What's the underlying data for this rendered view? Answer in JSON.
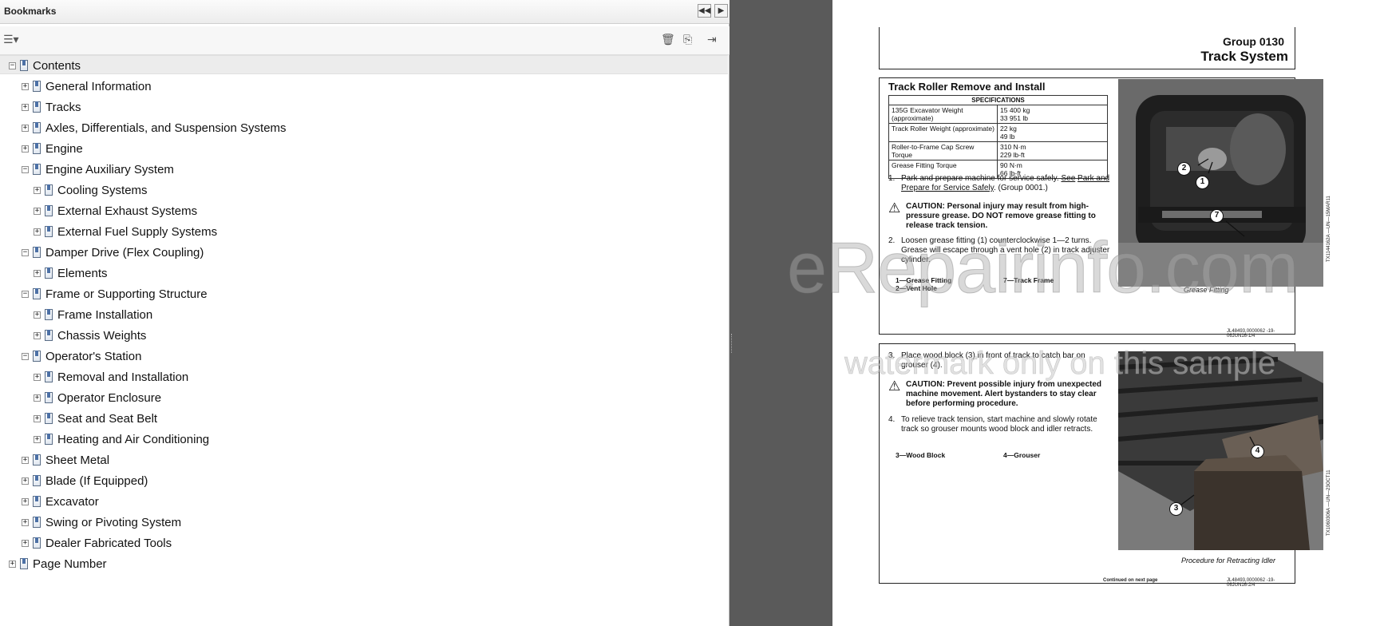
{
  "bookmarks": {
    "title": "Bookmarks",
    "header_buttons": [
      {
        "icon": "double-left-icon",
        "glyph": "◀◀"
      },
      {
        "icon": "play-right-icon",
        "glyph": "▶"
      }
    ],
    "toolbar": {
      "options_icon": "options-menu-icon",
      "delete_icon": "trash-icon",
      "new_bookmark_icon": "new-bookmark-icon",
      "expand_icon": "expand-bookmark-icon"
    },
    "tree": [
      {
        "label": "Contents",
        "level": 0,
        "expander": "−",
        "selected": true
      },
      {
        "label": "General Information",
        "level": 1,
        "expander": "+"
      },
      {
        "label": "Tracks",
        "level": 1,
        "expander": "+"
      },
      {
        "label": "Axles, Differentials, and Suspension Systems",
        "level": 1,
        "expander": "+"
      },
      {
        "label": "Engine",
        "level": 1,
        "expander": "+"
      },
      {
        "label": "Engine Auxiliary System",
        "level": 1,
        "expander": "−"
      },
      {
        "label": "Cooling Systems",
        "level": 2,
        "expander": "+"
      },
      {
        "label": "External Exhaust Systems",
        "level": 2,
        "expander": "+"
      },
      {
        "label": "External Fuel Supply Systems",
        "level": 2,
        "expander": "+"
      },
      {
        "label": "Damper Drive (Flex Coupling)",
        "level": 1,
        "expander": "−"
      },
      {
        "label": "Elements",
        "level": 2,
        "expander": "+"
      },
      {
        "label": "Frame or Supporting Structure",
        "level": 1,
        "expander": "−"
      },
      {
        "label": "Frame Installation",
        "level": 2,
        "expander": "+"
      },
      {
        "label": "Chassis Weights",
        "level": 2,
        "expander": "+"
      },
      {
        "label": "Operator's Station",
        "level": 1,
        "expander": "−"
      },
      {
        "label": "Removal and Installation",
        "level": 2,
        "expander": "+"
      },
      {
        "label": "Operator Enclosure",
        "level": 2,
        "expander": "+"
      },
      {
        "label": "Seat and Seat Belt",
        "level": 2,
        "expander": "+"
      },
      {
        "label": "Heating and Air Conditioning",
        "level": 2,
        "expander": "+"
      },
      {
        "label": "Sheet Metal",
        "level": 1,
        "expander": "+"
      },
      {
        "label": "Blade (If Equipped)",
        "level": 1,
        "expander": "+"
      },
      {
        "label": "Excavator",
        "level": 1,
        "expander": "+"
      },
      {
        "label": "Swing or Pivoting System",
        "level": 1,
        "expander": "+"
      },
      {
        "label": "Dealer Fabricated Tools",
        "level": 1,
        "expander": "+"
      },
      {
        "label": "Page Number",
        "level": 0,
        "expander": "+"
      }
    ]
  },
  "document": {
    "group": "Group  0130",
    "system": "Track System",
    "section1": {
      "title": "Track Roller Remove and Install",
      "spec_header": "SPECIFICATIONS",
      "specs": [
        {
          "name": "135G Excavator Weight (approximate)",
          "value": "15 400 kg\n33 951 lb"
        },
        {
          "name": "Track Roller Weight (approximate)",
          "value": "22 kg\n49 lb"
        },
        {
          "name": "Roller-to-Frame Cap Screw Torque",
          "value": "310 N·m\n229 lb-ft"
        },
        {
          "name": "Grease Fitting Torque",
          "value": "90 N·m\n66 lb-ft"
        }
      ],
      "step1_num": "1.",
      "step1_text": "Park and prepare machine for service safely.",
      "step1_link1": "See",
      "step1_link2": "Park and Prepare for Service Safely",
      "step1_ref": ". (Group 0001.)",
      "caution": "CAUTION: Personal injury may result from high-pressure grease. DO NOT remove grease fitting to release track tension.",
      "step2_num": "2.",
      "step2_text": "Loosen grease fitting (1) counterclockwise 1—2 turns. Grease will escape through a vent hole (2) in track adjuster cylinder.",
      "legend": [
        "1—Grease Fitting",
        "7—Track Frame",
        "2—Vent Hole"
      ],
      "figure_caption": "Grease Fitting",
      "figure_code": "TX1144162A —UN—15MAR11",
      "callouts": [
        "2",
        "1",
        "7"
      ],
      "footer_code": "JL48493,0000062 -19-06JUN16-1/4"
    },
    "section2": {
      "step3_num": "3.",
      "step3_text": "Place wood block (3) in front of track to catch bar on grouser (4).",
      "caution": "CAUTION: Prevent possible injury from unexpected machine movement. Alert bystanders to stay clear before performing procedure.",
      "step4_num": "4.",
      "step4_text": "To relieve track tension, start machine and slowly rotate track so grouser mounts wood block and idler retracts.",
      "legend": [
        "3—Wood Block",
        "4—Grouser"
      ],
      "figure_caption": "Procedure for Retracting Idler",
      "figure_code": "TX1060306A —UN—23OCT11",
      "callouts": [
        "4",
        "3"
      ],
      "continued": "Continued on next page",
      "footer_code": "JL48493,0000062 -19-06JUN16-2/4"
    },
    "watermark_main": "eRepairinfo.com",
    "watermark_sub": "watermark only on this sample"
  }
}
